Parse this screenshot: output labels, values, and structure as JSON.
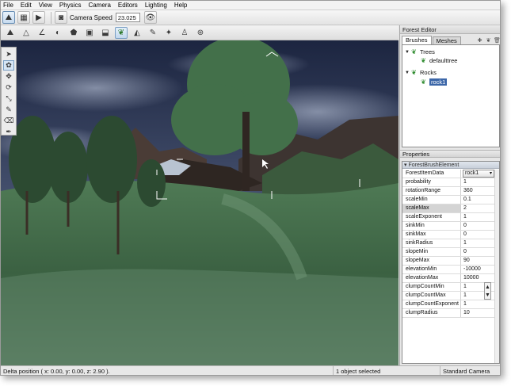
{
  "menu": [
    "File",
    "Edit",
    "View",
    "Physics",
    "Camera",
    "Editors",
    "Lighting",
    "Help"
  ],
  "toolbar": {
    "camera_speed_label": "Camera Speed",
    "camera_speed_value": "23.025"
  },
  "forest_editor": {
    "title": "Forest Editor",
    "tabs": [
      "Brushes",
      "Meshes"
    ],
    "tree": [
      {
        "label": "Trees",
        "level": 0
      },
      {
        "label": "defaulttree",
        "level": 1
      },
      {
        "label": "Rocks",
        "level": 0
      },
      {
        "label": "rock1",
        "level": 1,
        "selected": true
      }
    ]
  },
  "properties": {
    "title": "Properties",
    "group": "ForestBrushElement",
    "rows": [
      {
        "key": "ForestItemData",
        "value": "rock1"
      },
      {
        "key": "probability",
        "value": "1"
      },
      {
        "key": "rotationRange",
        "value": "360"
      },
      {
        "key": "scaleMin",
        "value": "0.1"
      },
      {
        "key": "scaleMax",
        "value": "2"
      },
      {
        "key": "scaleExponent",
        "value": "1"
      },
      {
        "key": "sinkMin",
        "value": "0"
      },
      {
        "key": "sinkMax",
        "value": "0"
      },
      {
        "key": "sinkRadius",
        "value": "1"
      },
      {
        "key": "slopeMin",
        "value": "0"
      },
      {
        "key": "slopeMax",
        "value": "90"
      },
      {
        "key": "elevationMin",
        "value": "-10000"
      },
      {
        "key": "elevationMax",
        "value": "10000"
      },
      {
        "key": "clumpCountMin",
        "value": "1"
      },
      {
        "key": "clumpCountMax",
        "value": "1"
      },
      {
        "key": "clumpCountExponent",
        "value": "1"
      },
      {
        "key": "clumpRadius",
        "value": "10"
      }
    ]
  },
  "status": {
    "delta": "Delta position ( x: 0.00, y: 0.00, z: 2.90 ).",
    "selection": "1 object selected",
    "camera": "Standard Camera"
  },
  "colors": {
    "sky_top": "#1c2540",
    "sky_bottom": "#6a7690",
    "grass": "#3f6b45",
    "selection_blue": "#3b66a8"
  }
}
